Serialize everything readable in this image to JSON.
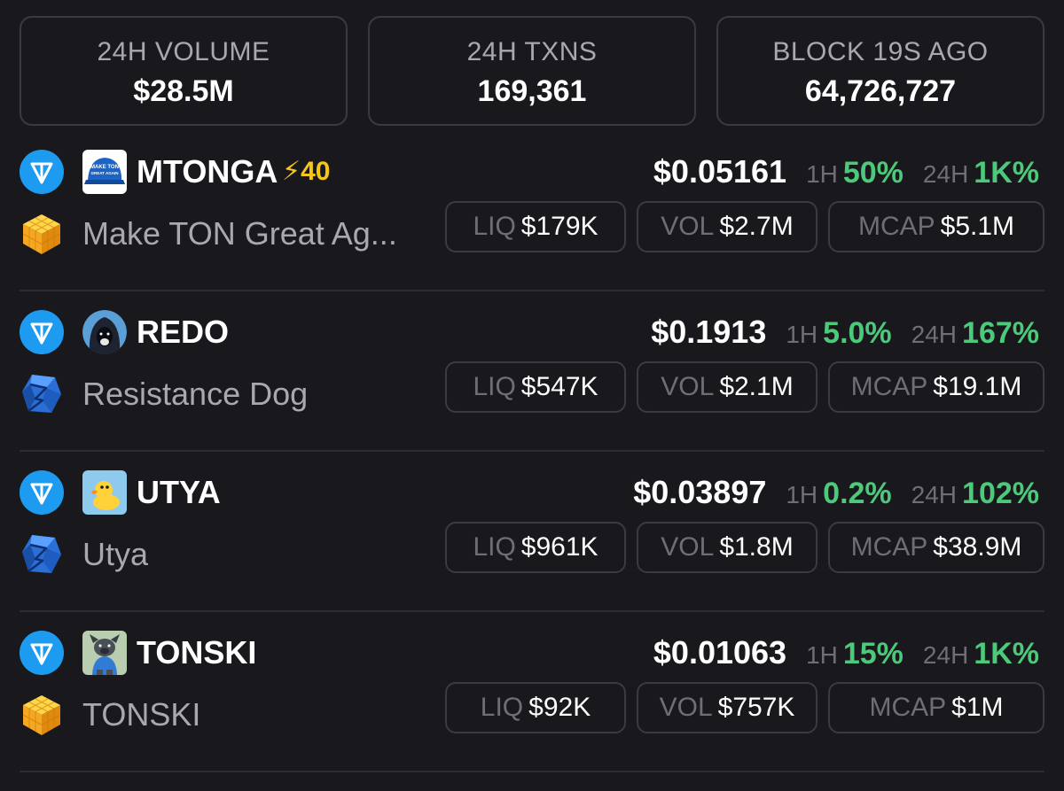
{
  "stats": [
    {
      "label": "24H VOLUME",
      "value": "$28.5M"
    },
    {
      "label": "24H TXNS",
      "value": "169,361"
    },
    {
      "label": "BLOCK 19S AGO",
      "value": "64,726,727"
    }
  ],
  "labels": {
    "h1": "1H",
    "h24": "24H",
    "liq": "LIQ",
    "vol": "VOL",
    "mcap": "MCAP"
  },
  "tokens": [
    {
      "ticker": "MTONGA",
      "boost": "⚡40",
      "name": "Make TON Great Ag...",
      "price": "$0.05161",
      "change_1h": "50%",
      "change_24h": "1K%",
      "liq": "$179K",
      "vol": "$2.7M",
      "mcap": "$5.1M",
      "dex_icon": "cube-icon",
      "token_image": "blue-cap-icon",
      "token_image_text": "MAKE TON GREAT AGAIN"
    },
    {
      "ticker": "REDO",
      "name": "Resistance Dog",
      "price": "$0.1913",
      "change_1h": "5.0%",
      "change_24h": "167%",
      "liq": "$547K",
      "vol": "$2.1M",
      "mcap": "$19.1M",
      "dex_icon": "dedust-icon",
      "token_image": "hooded-dog-icon"
    },
    {
      "ticker": "UTYA",
      "name": "Utya",
      "price": "$0.03897",
      "change_1h": "0.2%",
      "change_24h": "102%",
      "liq": "$961K",
      "vol": "$1.8M",
      "mcap": "$38.9M",
      "dex_icon": "dedust-icon",
      "token_image": "duck-icon"
    },
    {
      "ticker": "TONSKI",
      "name": "TONSKI",
      "price": "$0.01063",
      "change_1h": "15%",
      "change_24h": "1K%",
      "liq": "$92K",
      "vol": "$757K",
      "mcap": "$1M",
      "dex_icon": "cube-icon",
      "token_image": "dog-in-shirt-icon"
    }
  ],
  "colors": {
    "background": "#19191d",
    "border": "#3a3a40",
    "positive": "#4cc97a",
    "muted": "#6e6e74",
    "boost": "#f5c518",
    "ton_blue": "#1d9bf0"
  }
}
